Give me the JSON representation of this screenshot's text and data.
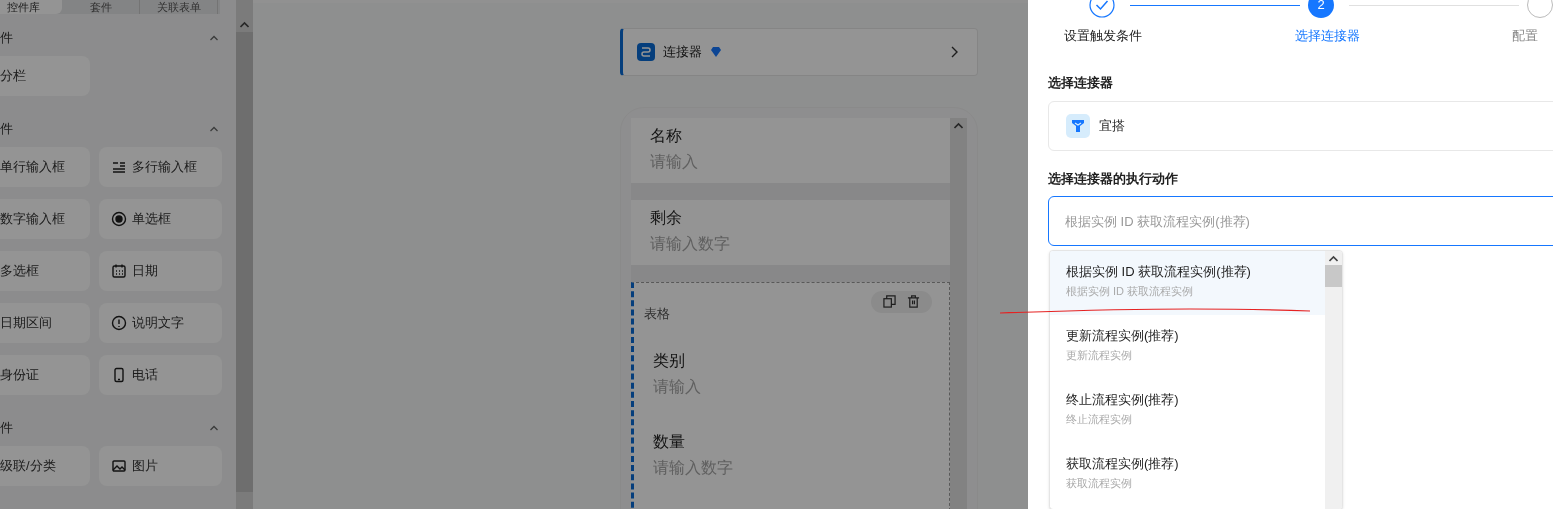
{
  "sidebar": {
    "tabs": [
      {
        "label": "控件库",
        "selected": true
      },
      {
        "label": "套件",
        "selected": false
      },
      {
        "label": "关联表单",
        "selected": false
      }
    ],
    "groups": [
      {
        "title": "件",
        "expanded": true,
        "items": [
          {
            "label": "分栏",
            "kind": "plain"
          }
        ]
      },
      {
        "title": "件",
        "expanded": true,
        "items": [
          {
            "label": "单行输入框",
            "kind": "plain"
          },
          {
            "label": "多行输入框",
            "kind": "textarea"
          },
          {
            "label": "数字输入框",
            "kind": "plain"
          },
          {
            "label": "单选框",
            "kind": "radio"
          },
          {
            "label": "多选框",
            "kind": "plain"
          },
          {
            "label": "日期",
            "kind": "date"
          },
          {
            "label": "日期区间",
            "kind": "plain"
          },
          {
            "label": "说明文字",
            "kind": "note"
          },
          {
            "label": "身份证",
            "kind": "plain"
          },
          {
            "label": "电话",
            "kind": "phone"
          }
        ]
      },
      {
        "title": "件",
        "expanded": true,
        "items": [
          {
            "label": "级联/分类",
            "kind": "plain"
          },
          {
            "label": "图片",
            "kind": "image"
          }
        ]
      }
    ]
  },
  "canvas": {
    "connector": {
      "label": "连接器"
    },
    "fields": [
      {
        "kind": "field",
        "label": "名称",
        "placeholder": "请输入"
      },
      {
        "kind": "field",
        "label": "剩余",
        "placeholder": "请输入数字"
      },
      {
        "kind": "table",
        "label": "表格",
        "selected": true,
        "children": [
          {
            "label": "类别",
            "placeholder": "请输入"
          },
          {
            "label": "数量",
            "placeholder": "请输入数字"
          }
        ]
      }
    ]
  },
  "drawer": {
    "steps": [
      {
        "label": "设置触发条件",
        "kind": "done"
      },
      {
        "label": "选择连接器",
        "kind": "current",
        "number": "2"
      },
      {
        "label": "配置",
        "kind": "pending"
      }
    ],
    "connector": {
      "label": "选择连接器",
      "value": "宜搭"
    },
    "action": {
      "label": "选择连接器的执行动作",
      "placeholder": "根据实例 ID 获取流程实例(推荐)",
      "focused": true
    },
    "options": [
      {
        "title": "根据实例 ID 获取流程实例(推荐)",
        "description": "根据实例 ID 获取流程实例",
        "selected": true
      },
      {
        "title": "更新流程实例(推荐)",
        "description": "更新流程实例",
        "selected": false
      },
      {
        "title": "终止流程实例(推荐)",
        "description": "终止流程实例",
        "selected": false
      },
      {
        "title": "获取流程实例(推荐)",
        "description": "获取流程实例",
        "selected": false
      }
    ]
  }
}
